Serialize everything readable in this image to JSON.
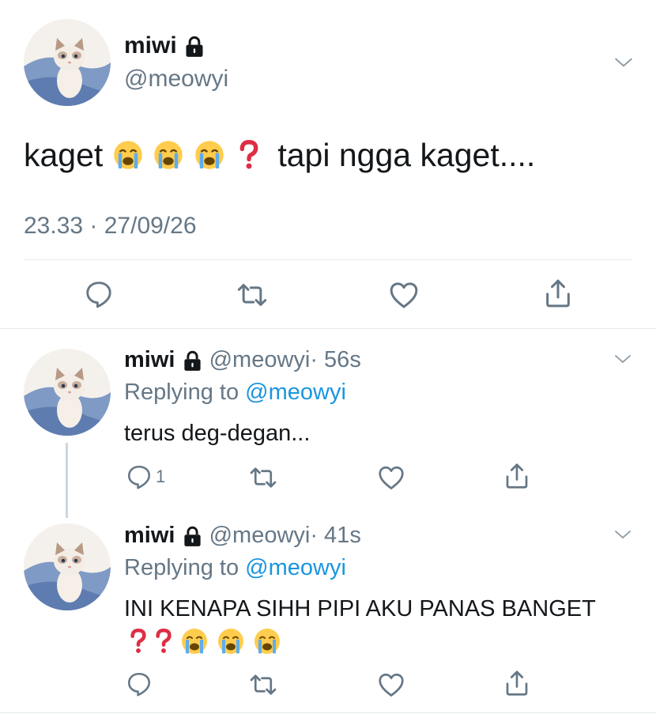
{
  "main_tweet": {
    "display_name": "miwi",
    "handle": "@meowyi",
    "text_part1": "kaget",
    "text_part2": "tapi ngga kaget....",
    "timestamp": "23.33 · 27/09/26",
    "icons": [
      "reply-icon",
      "retweet-icon",
      "like-icon",
      "share-icon"
    ]
  },
  "replies": [
    {
      "display_name": "miwi",
      "handle": "@meowyi",
      "time": "· 56s",
      "replying_prefix": "Replying to",
      "replying_handle": "@meowyi",
      "text": "terus deg-degan...",
      "reply_count": "1"
    },
    {
      "display_name": "miwi",
      "handle": "@meowyi",
      "time": "· 41s",
      "replying_prefix": "Replying to",
      "replying_handle": "@meowyi",
      "text": "INI KENAPA SIHH PIPI AKU PANAS BANGET",
      "reply_count": ""
    }
  ],
  "colors": {
    "link": "#1b95e0",
    "muted": "#657786",
    "divider": "#e1e8ed",
    "question_mark": "#dd2e44"
  }
}
